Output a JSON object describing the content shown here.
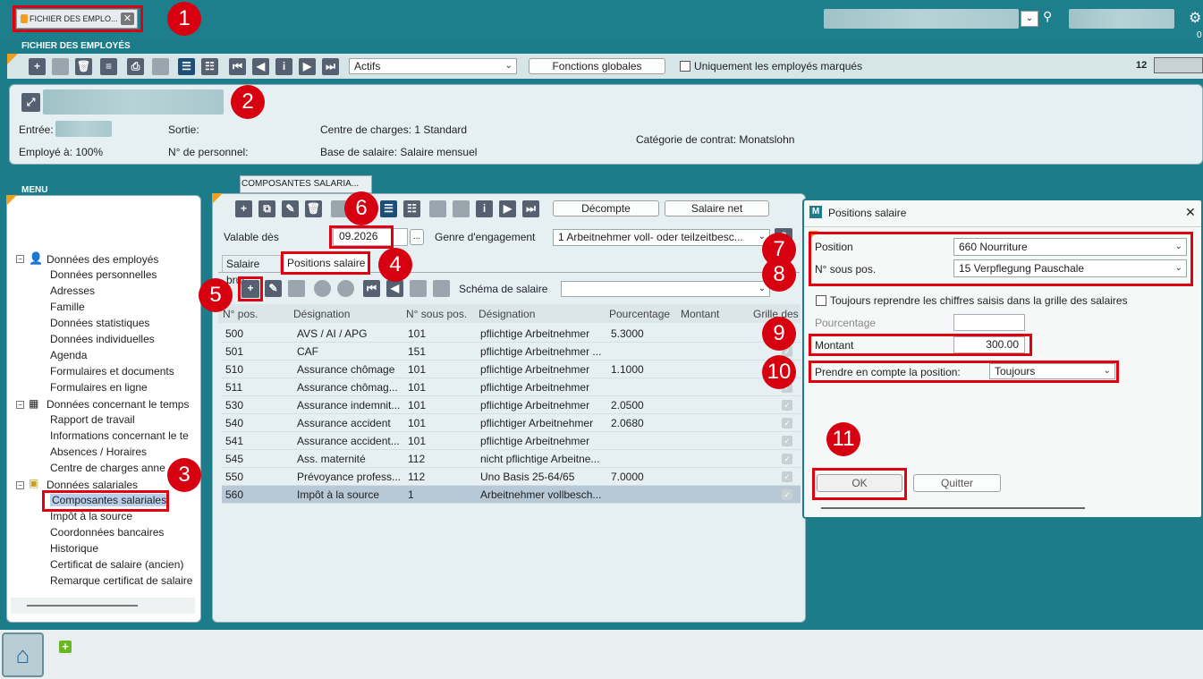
{
  "header": {
    "doc_tab": "FICHIER DES EMPLO...",
    "window_title": "FICHIER DES EMPLOYÉS",
    "page_count": "12"
  },
  "toolbar": {
    "filter_value": "Actifs",
    "global_functions": "Fonctions globales",
    "only_marked": "Uniquement les employés marqués"
  },
  "employee": {
    "entree": "Entrée:",
    "sortie": "Sortie:",
    "centre": "Centre de charges: 1 Standard",
    "employe_a": "Employé à: 100%",
    "n_personnel": "N° de personnel:",
    "base_salaire": "Base de salaire: Salaire mensuel",
    "categorie": "Catégorie de contrat: Monatslohn"
  },
  "menu": {
    "title": "MENU",
    "groups": [
      {
        "label": "Données des employés",
        "items": [
          "Données personnelles",
          "Adresses",
          "Famille",
          "Données statistiques",
          "Données individuelles",
          "Agenda",
          "Formulaires et documents",
          "Formulaires en ligne"
        ]
      },
      {
        "label": "Données concernant le temps",
        "items": [
          "Rapport de travail",
          "Informations concernant le te",
          "Absences / Horaires",
          "Centre de charges anne"
        ]
      },
      {
        "label": "Données salariales",
        "items": [
          "Composantes salariales",
          "Impôt à la source",
          "Coordonnées bancaires",
          "Historique",
          "Certificat de salaire (ancien)",
          "Remarque certificat de salaire"
        ]
      }
    ]
  },
  "salary": {
    "tab": "COMPOSANTES SALARIA...",
    "decompte": "Décompte",
    "salaire_net": "Salaire net",
    "valable_label": "Valable dès",
    "valable_value": "09.2026",
    "dots": "...",
    "genre_label": "Genre d'engagement",
    "genre_value": "1 Arbeitnehmer voll- oder teilzeitbesc...",
    "tab_brut": "Salaire brut",
    "tab_positions": "Positions salaire",
    "schema_label": "Schéma de salaire",
    "columns": [
      "N° pos.",
      "Désignation",
      "N° sous pos.",
      "Désignation",
      "Pourcentage",
      "Montant",
      "Grille des"
    ],
    "rows": [
      [
        "500",
        "AVS / AI / APG",
        "101",
        "pflichtige Arbeitnehmer",
        "5.3000",
        ""
      ],
      [
        "501",
        "CAF",
        "151",
        "pflichtige Arbeitnehmer ...",
        "",
        ""
      ],
      [
        "510",
        "Assurance chômage",
        "101",
        "pflichtige Arbeitnehmer",
        "1.1000",
        ""
      ],
      [
        "511",
        "Assurance chômag...",
        "101",
        "pflichtige Arbeitnehmer",
        "",
        ""
      ],
      [
        "530",
        "Assurance indemnit...",
        "101",
        "pflichtige Arbeitnehmer",
        "2.0500",
        ""
      ],
      [
        "540",
        "Assurance accident",
        "101",
        "pflichtiger Arbeitnehmer",
        "2.0680",
        ""
      ],
      [
        "541",
        "Assurance accident...",
        "101",
        "pflichtige Arbeitnehmer",
        "",
        ""
      ],
      [
        "545",
        "Ass. maternité",
        "112",
        "nicht pflichtige Arbeitne...",
        "",
        ""
      ],
      [
        "550",
        "Prévoyance profess...",
        "112",
        "Uno Basis 25-64/65",
        "7.0000",
        ""
      ],
      [
        "560",
        "Impôt à la source",
        "1",
        "Arbeitnehmer vollbesch...",
        "",
        ""
      ]
    ]
  },
  "dialog": {
    "icon": "M",
    "title": "Positions salaire",
    "close": "✕",
    "position_label": "Position",
    "position_value": "660 Nourriture",
    "subpos_label": "N° sous pos.",
    "subpos_value": "15 Verpflegung Pauschale",
    "always_label": "Toujours reprendre les chiffres saisis dans la grille des salaires",
    "pourcentage_label": "Pourcentage",
    "montant_label": "Montant",
    "montant_value": "300.00",
    "prendre_label": "Prendre en compte la position:",
    "prendre_value": "Toujours",
    "ok": "OK",
    "quitter": "Quitter"
  },
  "badges": [
    "1",
    "2",
    "3",
    "4",
    "5",
    "6",
    "7",
    "8",
    "9",
    "10",
    "11"
  ]
}
